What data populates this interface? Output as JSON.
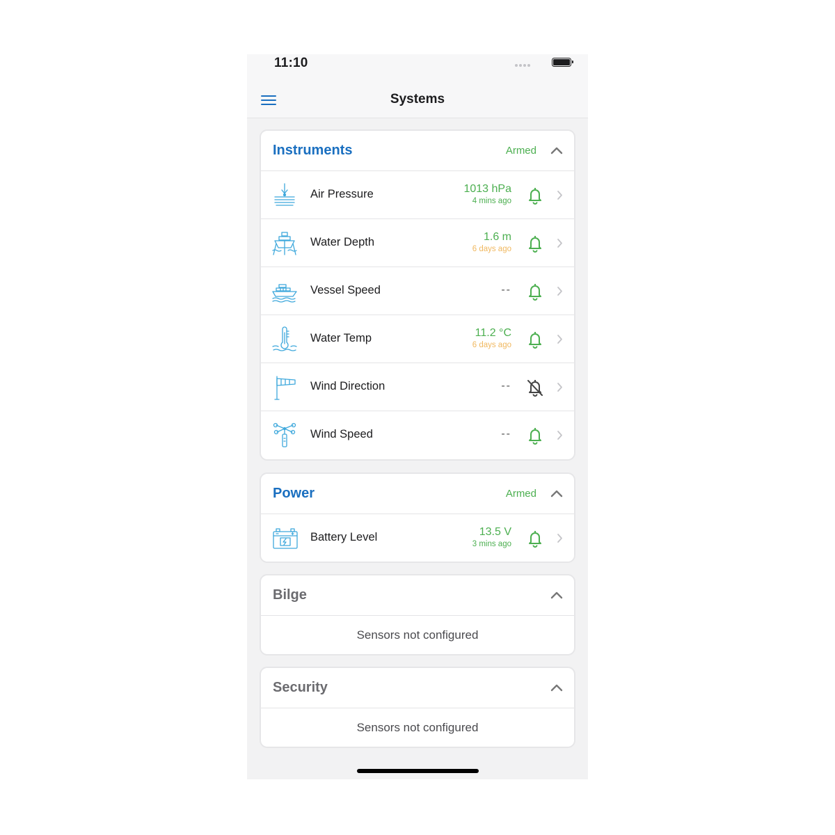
{
  "status_bar": {
    "time": "11:10"
  },
  "navbar": {
    "title": "Systems"
  },
  "sections": [
    {
      "title": "Instruments",
      "status": "Armed",
      "rows": [
        {
          "label": "Air Pressure",
          "value": "1013 hPa",
          "time": "4 mins ago",
          "time_color": "green",
          "icon": "barometer-icon",
          "bell": "bell-on"
        },
        {
          "label": "Water Depth",
          "value": "1.6 m",
          "time": "6 days ago",
          "time_color": "orange",
          "icon": "depth-boat-icon",
          "bell": "bell-on"
        },
        {
          "label": "Vessel Speed",
          "value": "--",
          "time": "",
          "icon": "speedboat-icon",
          "bell": "bell-on"
        },
        {
          "label": "Water Temp",
          "value": "11.2 °C",
          "time": "6 days ago",
          "time_color": "orange",
          "icon": "water-thermometer-icon",
          "bell": "bell-on"
        },
        {
          "label": "Wind Direction",
          "value": "--",
          "time": "",
          "icon": "windsock-icon",
          "bell": "bell-off"
        },
        {
          "label": "Wind Speed",
          "value": "--",
          "time": "",
          "icon": "anemometer-icon",
          "bell": "bell-on"
        }
      ]
    },
    {
      "title": "Power",
      "status": "Armed",
      "rows": [
        {
          "label": "Battery Level",
          "value": "13.5 V",
          "time": "3 mins ago",
          "time_color": "green",
          "icon": "battery-icon",
          "bell": "bell-on"
        }
      ]
    },
    {
      "title": "Bilge",
      "empty": "Sensors not configured"
    },
    {
      "title": "Security",
      "empty": "Sensors not configured"
    }
  ],
  "colors": {
    "accent": "#1a6fc0",
    "armed": "#4caf50",
    "stale": "#f0b860",
    "icon": "#3ea8dc"
  }
}
